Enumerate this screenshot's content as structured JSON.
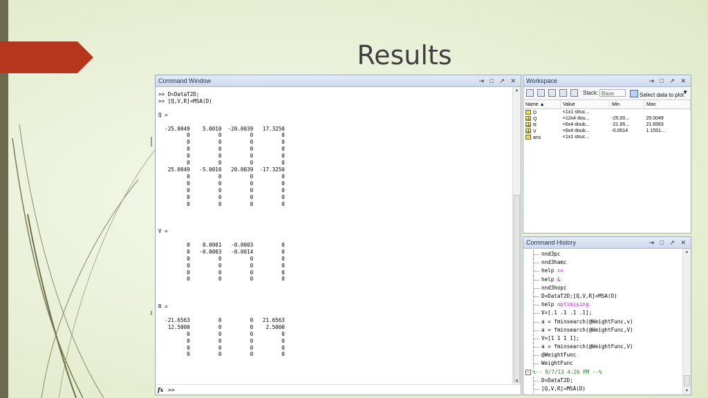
{
  "slide": {
    "title": "Results"
  },
  "command_window": {
    "title": "Command Window",
    "controls": "⇥ □ ↗ ✕",
    "content": ">> D=DataT2D;\n>> [Q,V,R]=MSA(D)\n\nQ =\n\n  -25.0049    5.0010  -20.0039   17.3250\n         0         0         0         0\n         0         0         0         0\n         0         0         0         0\n         0         0         0         0\n         0         0         0         0\n   25.0049   -5.0010   20.0039  -17.3250\n         0         0         0         0\n         0         0         0         0\n         0         0         0         0\n         0         0         0         0\n         0         0         0         0\n\n\n\nV =\n\n         0    0.0001   -0.0003         0\n         0   -0.0003   -0.0014         0\n         0         0         0         0\n         0         0         0         0\n         0         0         0         0\n         0         0         0         0\n\n\n\nR =\n\n  -21.6563         0         0   21.6563\n   12.5000         0         0    2.5000\n         0         0         0         0\n         0         0         0         0\n         0         0         0         0\n         0         0         0         0",
    "fx_label": "fx",
    "prompt": ">>"
  },
  "workspace": {
    "title": "Workspace",
    "controls": "⇥ □ ↗ ✕",
    "stack_label": "Stack:",
    "stack_value": "Base",
    "plot_button": "Select data to plot",
    "columns": [
      "Name ▲",
      "Value",
      "Min",
      "Max"
    ],
    "rows": [
      {
        "name": "D",
        "value": "<1x1 struc...",
        "min": "",
        "max": "",
        "icon": "struct-icon"
      },
      {
        "name": "Q",
        "value": "<12x4 dou...",
        "min": "-25.00...",
        "max": "25.0049",
        "icon": "matrix-icon"
      },
      {
        "name": "R",
        "value": "<6x4 doub...",
        "min": "-21.65...",
        "max": "21.6563",
        "icon": "matrix-icon"
      },
      {
        "name": "V",
        "value": "<6x4 doub...",
        "min": "-0.0014",
        "max": "1.1551...",
        "icon": "matrix-icon"
      },
      {
        "name": "ans",
        "value": "<1x1 struc...",
        "min": "",
        "max": "",
        "icon": "struct-icon"
      }
    ]
  },
  "history": {
    "title": "Command History",
    "controls": "⇥ □ ↗ ✕",
    "items": [
      {
        "text": "nnd3pc"
      },
      {
        "text": "nnd3hamc"
      },
      {
        "text": "help ",
        "kw": "=="
      },
      {
        "text": "help ",
        "kw": "&"
      },
      {
        "text": "nnd3hopc"
      },
      {
        "text": "D=DataT2D;[Q,V,R]=MSA(D)"
      },
      {
        "text": "help ",
        "kw": "optimising"
      },
      {
        "text": "V=[.1 .1 .1 .1];"
      },
      {
        "text": "a = fminsearch(@WeightFunc,v)"
      },
      {
        "text": "a = fminsearch(@WeightFunc,V)"
      },
      {
        "text": "V=[1 1 1 1];"
      },
      {
        "text": "a = fminsearch(@WeightFunc,V)"
      },
      {
        "text": "@WeightFunc"
      },
      {
        "text": "WeightFunc"
      },
      {
        "text": "%-- 9/7/13  4:26 PM --%",
        "session": true
      },
      {
        "text": "D=DataT2D;"
      },
      {
        "text": "[Q,V,R]=MSA(D)"
      }
    ]
  }
}
